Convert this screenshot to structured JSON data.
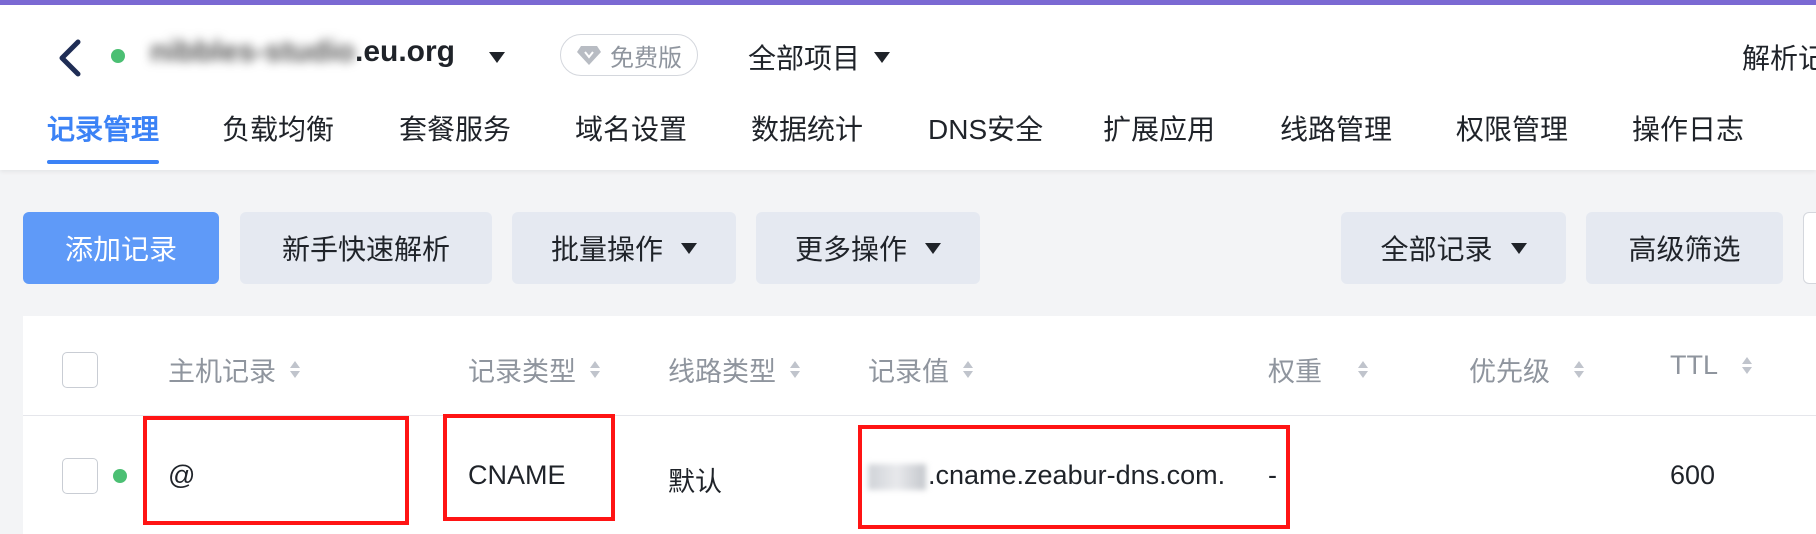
{
  "header": {
    "domain": {
      "masked_part": "nibbles-studio",
      "visible_part": ".eu.org"
    },
    "badge_label": "免费版",
    "project_selector": "全部项目",
    "right_cut_label": "解析记"
  },
  "tabs": [
    {
      "label": "记录管理",
      "active": true
    },
    {
      "label": "负载均衡"
    },
    {
      "label": "套餐服务"
    },
    {
      "label": "域名设置"
    },
    {
      "label": "数据统计"
    },
    {
      "label": "DNS安全"
    },
    {
      "label": "扩展应用"
    },
    {
      "label": "线路管理"
    },
    {
      "label": "权限管理"
    },
    {
      "label": "操作日志"
    }
  ],
  "toolbar": {
    "add_record": "添加记录",
    "quick_setup": "新手快速解析",
    "batch_ops": "批量操作",
    "more_ops": "更多操作",
    "all_records": "全部记录",
    "advanced_filter": "高级筛选"
  },
  "table": {
    "columns": [
      "主机记录",
      "记录类型",
      "线路类型",
      "记录值",
      "权重",
      "优先级",
      "TTL"
    ],
    "rows": [
      {
        "host": "@",
        "type": "CNAME",
        "line": "默认",
        "value_visible": ".cname.zeabur-dns.com.",
        "weight": "-",
        "priority": "",
        "ttl": "600",
        "status_color": "#4bbf73"
      }
    ]
  },
  "colors": {
    "accent": "#3b82f6",
    "primary_button": "#5f9af8",
    "status_green": "#4bbf73",
    "highlight_red": "#ff1414"
  }
}
